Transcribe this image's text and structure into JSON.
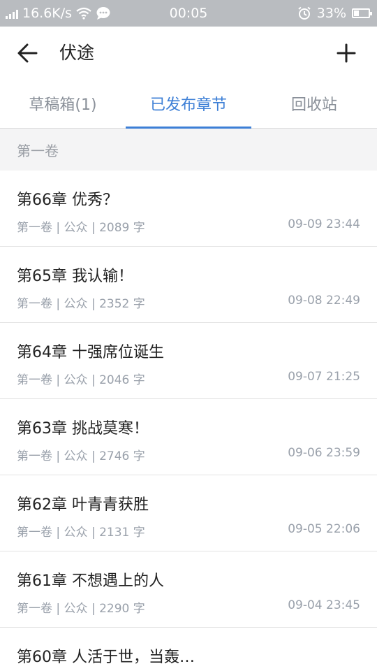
{
  "status_bar": {
    "net_speed": "16.6K/s",
    "time": "00:05",
    "battery": "33%",
    "battery_level": 0.33,
    "icons": [
      "signal-icon",
      "wifi-icon",
      "chat-bubble-icon",
      "alarm-icon",
      "battery-icon"
    ]
  },
  "header": {
    "title": "伏途",
    "back_icon": "arrow-left-icon",
    "add_icon": "plus-icon"
  },
  "tabs": [
    {
      "label": "草稿箱(1)",
      "active": false
    },
    {
      "label": "已发布章节",
      "active": true
    },
    {
      "label": "回收站",
      "active": false
    }
  ],
  "colors": {
    "accent": "#3d7fd6",
    "status_bar_bg": "#b9bcc0",
    "section_bg": "#f4f4f5",
    "meta_text": "#9aa1ab"
  },
  "volume_header": "第一卷",
  "chapters": [
    {
      "title": "第66章 优秀？",
      "meta": "第一卷 | 公众 | 2089 字",
      "date": "09-09 23:44"
    },
    {
      "title": "第65章 我认输！",
      "meta": "第一卷 | 公众 | 2352 字",
      "date": "09-08 22:49"
    },
    {
      "title": "第64章 十强席位诞生",
      "meta": "第一卷 | 公众 | 2046 字",
      "date": "09-07 21:25"
    },
    {
      "title": "第63章 挑战莫寒！",
      "meta": "第一卷 | 公众 | 2746 字",
      "date": "09-06 23:59"
    },
    {
      "title": "第62章 叶青青获胜",
      "meta": "第一卷 | 公众 | 2131 字",
      "date": "09-05 22:06"
    },
    {
      "title": "第61章 不想遇上的人",
      "meta": "第一卷 | 公众 | 2290 字",
      "date": "09-04 23:45"
    },
    {
      "title": "第60章 人活于世，当轰…",
      "meta": "",
      "date": ""
    }
  ]
}
